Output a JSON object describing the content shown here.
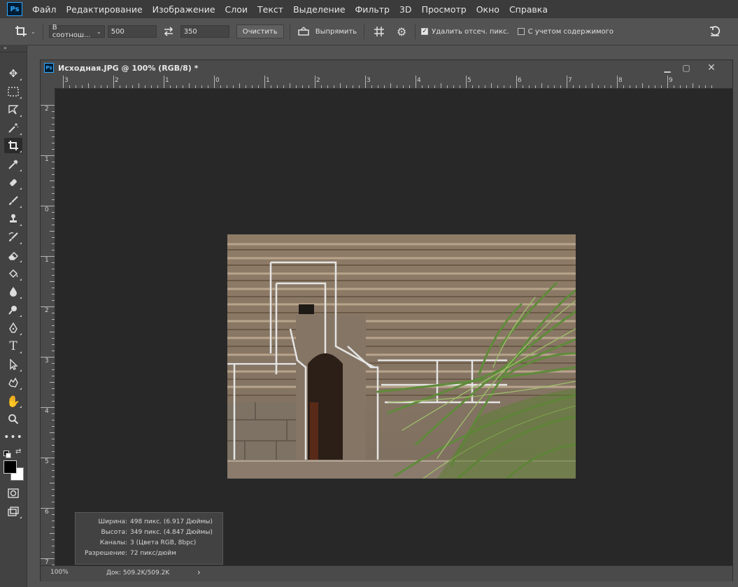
{
  "app": {
    "logo": "Ps"
  },
  "menu": [
    "Файл",
    "Редактирование",
    "Изображение",
    "Слои",
    "Текст",
    "Выделение",
    "Фильтр",
    "3D",
    "Просмотр",
    "Окно",
    "Справка"
  ],
  "options": {
    "ratio_select": "В соотнош...",
    "width_value": "500",
    "height_value": "350",
    "clear_label": "Очистить",
    "straighten_label": "Выпрямить",
    "delete_cropped_label": "Удалить отсеч. пикс.",
    "delete_cropped_checked": true,
    "content_aware_label": "С учетом содержимого",
    "content_aware_checked": false
  },
  "document": {
    "title": "Исходная.JPG @ 100% (RGB/8) *",
    "ruler_top": [
      "3",
      "2",
      "1",
      "0",
      "1",
      "2",
      "3",
      "4",
      "5",
      "6",
      "7",
      "8",
      "9"
    ],
    "ruler_left": [
      "2",
      "1",
      "0",
      "1",
      "2",
      "3",
      "4",
      "5",
      "6",
      "7"
    ]
  },
  "status": {
    "zoom": "100%",
    "doc_size": "Док: 509.2K/509.2K",
    "arrow": "›"
  },
  "info": {
    "rows": [
      {
        "label": "Ширина:",
        "value": "498 пикс. (6.917 Дюймы)"
      },
      {
        "label": "Высота:",
        "value": "349 пикс. (4.847 Дюймы)"
      },
      {
        "label": "Каналы:",
        "value": "3 (Цвета RGB, 8bpc)"
      },
      {
        "label": "Разрешение:",
        "value": "72 пикс/дюйм"
      }
    ]
  },
  "colors": {
    "foreground": "#000000",
    "background": "#ffffff",
    "accent": "#31a8ff"
  }
}
